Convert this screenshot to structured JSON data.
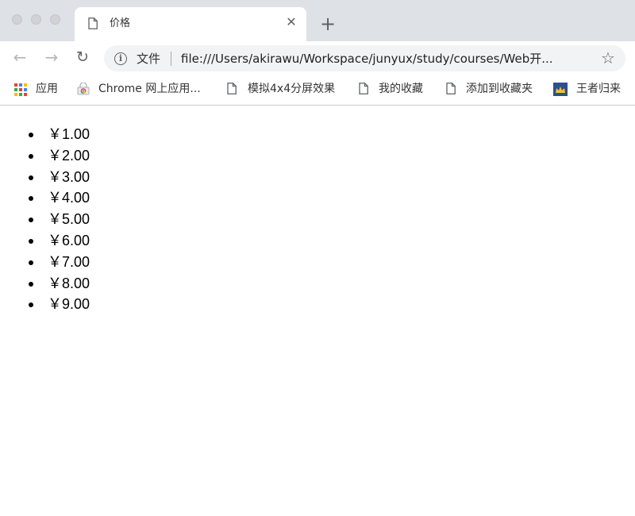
{
  "window": {
    "tab": {
      "title": "价格",
      "icon": "page-icon",
      "close_icon": "close-icon"
    },
    "new_tab_icon": "plus-icon"
  },
  "toolbar": {
    "back_icon": "arrow-left-icon",
    "forward_icon": "arrow-right-icon",
    "reload_icon": "reload-icon",
    "scheme_label": "文件",
    "url": "file:///Users/akirawu/Workspace/junyux/study/courses/Web开...",
    "bookmark_star_icon": "star-icon"
  },
  "bookmarks": [
    {
      "label": "应用",
      "icon": "apps-grid-icon"
    },
    {
      "label": "Chrome 网上应用...",
      "icon": "chrome-web-store-icon"
    },
    {
      "label": "模拟4x4分屏效果",
      "icon": "page-icon"
    },
    {
      "label": "我的收藏",
      "icon": "page-icon"
    },
    {
      "label": "添加到收藏夹",
      "icon": "page-icon"
    },
    {
      "label": "王者归来",
      "icon": "site-favicon-icon"
    }
  ],
  "page": {
    "prices": [
      "￥1.00",
      "￥2.00",
      "￥3.00",
      "￥4.00",
      "￥5.00",
      "￥6.00",
      "￥7.00",
      "￥8.00",
      "￥9.00"
    ]
  },
  "colors": {
    "tabstrip_bg": "#dee1e6",
    "omnibox_bg": "#f1f3f4",
    "icon_gray": "#5f6368",
    "disabled_gray": "#b4b7bb"
  }
}
